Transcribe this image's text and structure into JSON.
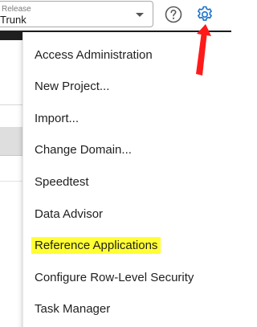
{
  "header": {
    "select_label": "Release",
    "select_value": "Trunk"
  },
  "menu": {
    "items": [
      {
        "label": "Access Administration"
      },
      {
        "label": "New Project..."
      },
      {
        "label": "Import..."
      },
      {
        "label": "Change Domain..."
      },
      {
        "label": "Speedtest"
      },
      {
        "label": "Data Advisor"
      },
      {
        "label": "Reference Applications",
        "highlighted": true
      },
      {
        "label": "Configure Row-Level Security"
      },
      {
        "label": "Task Manager"
      }
    ]
  },
  "colors": {
    "accent": "#1a73c9",
    "highlight": "#ffff33",
    "annotation_arrow": "#ff1a1a",
    "toolbar_strip": "#1f1f1f"
  },
  "icons": {
    "select_caret": "chevron-down-icon",
    "help": "help-icon",
    "settings": "gear-icon",
    "annotation": "red-arrow"
  }
}
